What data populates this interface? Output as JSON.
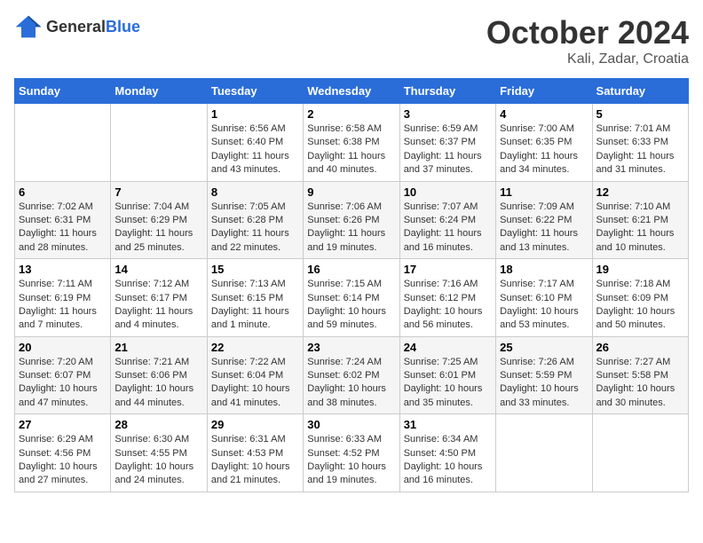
{
  "header": {
    "logo_general": "General",
    "logo_blue": "Blue",
    "month_year": "October 2024",
    "location": "Kali, Zadar, Croatia"
  },
  "weekdays": [
    "Sunday",
    "Monday",
    "Tuesday",
    "Wednesday",
    "Thursday",
    "Friday",
    "Saturday"
  ],
  "weeks": [
    [
      {
        "day": "",
        "sunrise": "",
        "sunset": "",
        "daylight": "",
        "empty": true
      },
      {
        "day": "",
        "sunrise": "",
        "sunset": "",
        "daylight": "",
        "empty": true
      },
      {
        "day": "1",
        "sunrise": "Sunrise: 6:56 AM",
        "sunset": "Sunset: 6:40 PM",
        "daylight": "Daylight: 11 hours and 43 minutes."
      },
      {
        "day": "2",
        "sunrise": "Sunrise: 6:58 AM",
        "sunset": "Sunset: 6:38 PM",
        "daylight": "Daylight: 11 hours and 40 minutes."
      },
      {
        "day": "3",
        "sunrise": "Sunrise: 6:59 AM",
        "sunset": "Sunset: 6:37 PM",
        "daylight": "Daylight: 11 hours and 37 minutes."
      },
      {
        "day": "4",
        "sunrise": "Sunrise: 7:00 AM",
        "sunset": "Sunset: 6:35 PM",
        "daylight": "Daylight: 11 hours and 34 minutes."
      },
      {
        "day": "5",
        "sunrise": "Sunrise: 7:01 AM",
        "sunset": "Sunset: 6:33 PM",
        "daylight": "Daylight: 11 hours and 31 minutes."
      }
    ],
    [
      {
        "day": "6",
        "sunrise": "Sunrise: 7:02 AM",
        "sunset": "Sunset: 6:31 PM",
        "daylight": "Daylight: 11 hours and 28 minutes."
      },
      {
        "day": "7",
        "sunrise": "Sunrise: 7:04 AM",
        "sunset": "Sunset: 6:29 PM",
        "daylight": "Daylight: 11 hours and 25 minutes."
      },
      {
        "day": "8",
        "sunrise": "Sunrise: 7:05 AM",
        "sunset": "Sunset: 6:28 PM",
        "daylight": "Daylight: 11 hours and 22 minutes."
      },
      {
        "day": "9",
        "sunrise": "Sunrise: 7:06 AM",
        "sunset": "Sunset: 6:26 PM",
        "daylight": "Daylight: 11 hours and 19 minutes."
      },
      {
        "day": "10",
        "sunrise": "Sunrise: 7:07 AM",
        "sunset": "Sunset: 6:24 PM",
        "daylight": "Daylight: 11 hours and 16 minutes."
      },
      {
        "day": "11",
        "sunrise": "Sunrise: 7:09 AM",
        "sunset": "Sunset: 6:22 PM",
        "daylight": "Daylight: 11 hours and 13 minutes."
      },
      {
        "day": "12",
        "sunrise": "Sunrise: 7:10 AM",
        "sunset": "Sunset: 6:21 PM",
        "daylight": "Daylight: 11 hours and 10 minutes."
      }
    ],
    [
      {
        "day": "13",
        "sunrise": "Sunrise: 7:11 AM",
        "sunset": "Sunset: 6:19 PM",
        "daylight": "Daylight: 11 hours and 7 minutes."
      },
      {
        "day": "14",
        "sunrise": "Sunrise: 7:12 AM",
        "sunset": "Sunset: 6:17 PM",
        "daylight": "Daylight: 11 hours and 4 minutes."
      },
      {
        "day": "15",
        "sunrise": "Sunrise: 7:13 AM",
        "sunset": "Sunset: 6:15 PM",
        "daylight": "Daylight: 11 hours and 1 minute."
      },
      {
        "day": "16",
        "sunrise": "Sunrise: 7:15 AM",
        "sunset": "Sunset: 6:14 PM",
        "daylight": "Daylight: 10 hours and 59 minutes."
      },
      {
        "day": "17",
        "sunrise": "Sunrise: 7:16 AM",
        "sunset": "Sunset: 6:12 PM",
        "daylight": "Daylight: 10 hours and 56 minutes."
      },
      {
        "day": "18",
        "sunrise": "Sunrise: 7:17 AM",
        "sunset": "Sunset: 6:10 PM",
        "daylight": "Daylight: 10 hours and 53 minutes."
      },
      {
        "day": "19",
        "sunrise": "Sunrise: 7:18 AM",
        "sunset": "Sunset: 6:09 PM",
        "daylight": "Daylight: 10 hours and 50 minutes."
      }
    ],
    [
      {
        "day": "20",
        "sunrise": "Sunrise: 7:20 AM",
        "sunset": "Sunset: 6:07 PM",
        "daylight": "Daylight: 10 hours and 47 minutes."
      },
      {
        "day": "21",
        "sunrise": "Sunrise: 7:21 AM",
        "sunset": "Sunset: 6:06 PM",
        "daylight": "Daylight: 10 hours and 44 minutes."
      },
      {
        "day": "22",
        "sunrise": "Sunrise: 7:22 AM",
        "sunset": "Sunset: 6:04 PM",
        "daylight": "Daylight: 10 hours and 41 minutes."
      },
      {
        "day": "23",
        "sunrise": "Sunrise: 7:24 AM",
        "sunset": "Sunset: 6:02 PM",
        "daylight": "Daylight: 10 hours and 38 minutes."
      },
      {
        "day": "24",
        "sunrise": "Sunrise: 7:25 AM",
        "sunset": "Sunset: 6:01 PM",
        "daylight": "Daylight: 10 hours and 35 minutes."
      },
      {
        "day": "25",
        "sunrise": "Sunrise: 7:26 AM",
        "sunset": "Sunset: 5:59 PM",
        "daylight": "Daylight: 10 hours and 33 minutes."
      },
      {
        "day": "26",
        "sunrise": "Sunrise: 7:27 AM",
        "sunset": "Sunset: 5:58 PM",
        "daylight": "Daylight: 10 hours and 30 minutes."
      }
    ],
    [
      {
        "day": "27",
        "sunrise": "Sunrise: 6:29 AM",
        "sunset": "Sunset: 4:56 PM",
        "daylight": "Daylight: 10 hours and 27 minutes."
      },
      {
        "day": "28",
        "sunrise": "Sunrise: 6:30 AM",
        "sunset": "Sunset: 4:55 PM",
        "daylight": "Daylight: 10 hours and 24 minutes."
      },
      {
        "day": "29",
        "sunrise": "Sunrise: 6:31 AM",
        "sunset": "Sunset: 4:53 PM",
        "daylight": "Daylight: 10 hours and 21 minutes."
      },
      {
        "day": "30",
        "sunrise": "Sunrise: 6:33 AM",
        "sunset": "Sunset: 4:52 PM",
        "daylight": "Daylight: 10 hours and 19 minutes."
      },
      {
        "day": "31",
        "sunrise": "Sunrise: 6:34 AM",
        "sunset": "Sunset: 4:50 PM",
        "daylight": "Daylight: 10 hours and 16 minutes."
      },
      {
        "day": "",
        "sunrise": "",
        "sunset": "",
        "daylight": "",
        "empty": true
      },
      {
        "day": "",
        "sunrise": "",
        "sunset": "",
        "daylight": "",
        "empty": true
      }
    ]
  ]
}
